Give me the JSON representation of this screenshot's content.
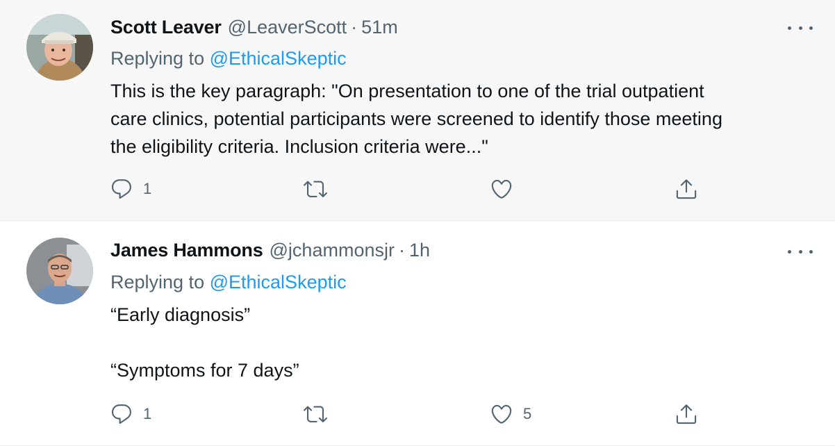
{
  "tweets": [
    {
      "author_name": "Scott Leaver",
      "handle": "@LeaverScott",
      "separator": "·",
      "time": "51m",
      "replying_prefix": "Replying to",
      "replying_to": "@EthicalSkeptic",
      "body_lines": [
        "This is the key paragraph:  \"On presentation to one of the trial outpatient",
        "care clinics, potential participants were screened to identify those meeting",
        "the eligibility criteria. Inclusion criteria were...\""
      ],
      "reply_count": "1",
      "retweet_count": "",
      "like_count": "",
      "icons": {
        "reply": "reply-icon",
        "retweet": "retweet-icon",
        "like": "heart-icon",
        "share": "share-icon",
        "more": "more-icon"
      }
    },
    {
      "author_name": "James Hammons",
      "handle": "@jchammonsjr",
      "separator": "·",
      "time": "1h",
      "replying_prefix": "Replying to",
      "replying_to": "@EthicalSkeptic",
      "body_lines": [
        "“Early diagnosis”",
        "",
        "“Symptoms for 7 days”"
      ],
      "reply_count": "1",
      "retweet_count": "",
      "like_count": "5",
      "icons": {
        "reply": "reply-icon",
        "retweet": "retweet-icon",
        "like": "heart-icon",
        "share": "share-icon",
        "more": "more-icon"
      }
    }
  ],
  "colors": {
    "text": "#0f1419",
    "secondary": "#536471",
    "link": "#1d9bf0",
    "highlight_bg": "#f7f7f7",
    "divider": "#e6ecf0"
  }
}
